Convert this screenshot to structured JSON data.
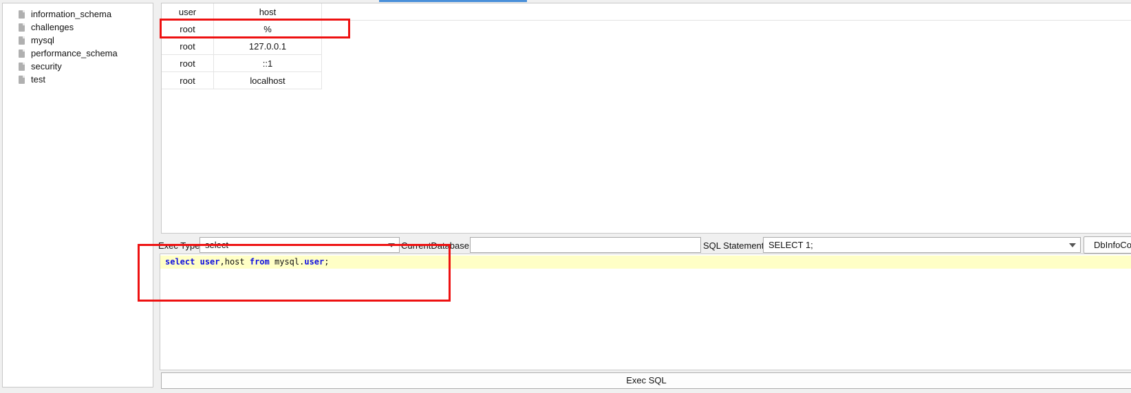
{
  "databases": [
    "information_schema",
    "challenges",
    "mysql",
    "performance_schema",
    "security",
    "test"
  ],
  "result": {
    "columns": [
      "user",
      "host"
    ],
    "rows": [
      [
        "root",
        "%"
      ],
      [
        "root",
        "127.0.0.1"
      ],
      [
        "root",
        "::1"
      ],
      [
        "root",
        "localhost"
      ]
    ]
  },
  "controls": {
    "exec_type_label": "Exec Type",
    "exec_type_value": "select",
    "current_db_label": "CurrentDatabase",
    "current_db_value": "",
    "sql_statement_label": "SQL Statement",
    "sql_statement_value": "SELECT 1;",
    "dbinfo_button": "DbInfoCo"
  },
  "editor": {
    "tokens": [
      {
        "text": "select",
        "type": "kw"
      },
      {
        "text": " ",
        "type": "tx"
      },
      {
        "text": "user",
        "type": "kw"
      },
      {
        "text": ",host ",
        "type": "tx"
      },
      {
        "text": "from",
        "type": "kw"
      },
      {
        "text": " mysql.",
        "type": "tx"
      },
      {
        "text": "user",
        "type": "kw"
      },
      {
        "text": ";",
        "type": "tx"
      }
    ]
  },
  "exec_button": "Exec SQL",
  "colors": {
    "annotation": "#ee1111",
    "keyword": "#1010e0",
    "current_line": "#ffffc6"
  }
}
